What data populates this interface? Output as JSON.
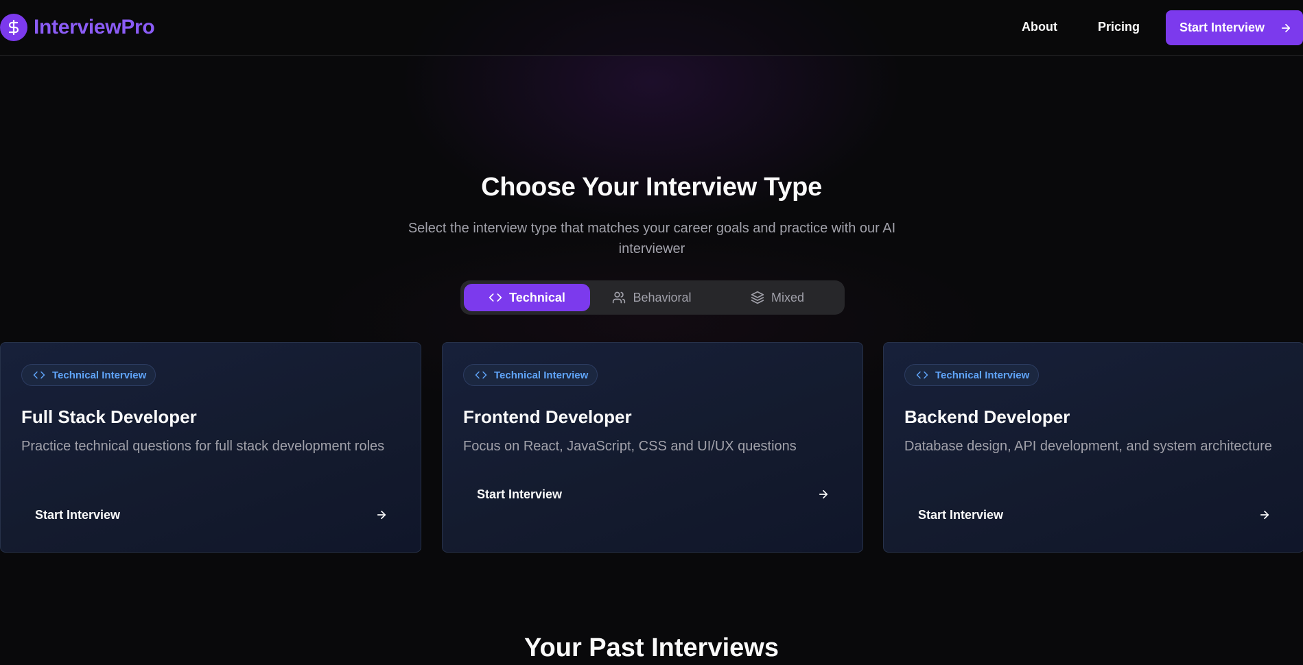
{
  "brand": {
    "name": "InterviewPro",
    "logo_icon": "dollar-icon"
  },
  "nav": {
    "about": "About",
    "pricing": "Pricing",
    "cta": "Start Interview",
    "cta_icon": "arrow-right-icon"
  },
  "section": {
    "title": "Choose Your Interview Type",
    "subtitle": "Select the interview type that matches your career goals and practice with our AI interviewer"
  },
  "tabs": [
    {
      "label": "Technical",
      "icon": "code-icon",
      "active": true
    },
    {
      "label": "Behavioral",
      "icon": "users-icon",
      "active": false
    },
    {
      "label": "Mixed",
      "icon": "layers-icon",
      "active": false
    }
  ],
  "cards": [
    {
      "badge": "Technical Interview",
      "title": "Full Stack Developer",
      "description": "Practice technical questions for full stack development roles",
      "button": "Start Interview"
    },
    {
      "badge": "Technical Interview",
      "title": "Frontend Developer",
      "description": "Focus on React, JavaScript, CSS and UI/UX questions",
      "button": "Start Interview"
    },
    {
      "badge": "Technical Interview",
      "title": "Backend Developer",
      "description": "Database design, API development, and system architecture",
      "button": "Start Interview"
    }
  ],
  "past": {
    "title": "Your Past Interviews"
  },
  "colors": {
    "accent": "#7c3aed",
    "badge_text": "#60a5fa",
    "background": "#09090b"
  }
}
